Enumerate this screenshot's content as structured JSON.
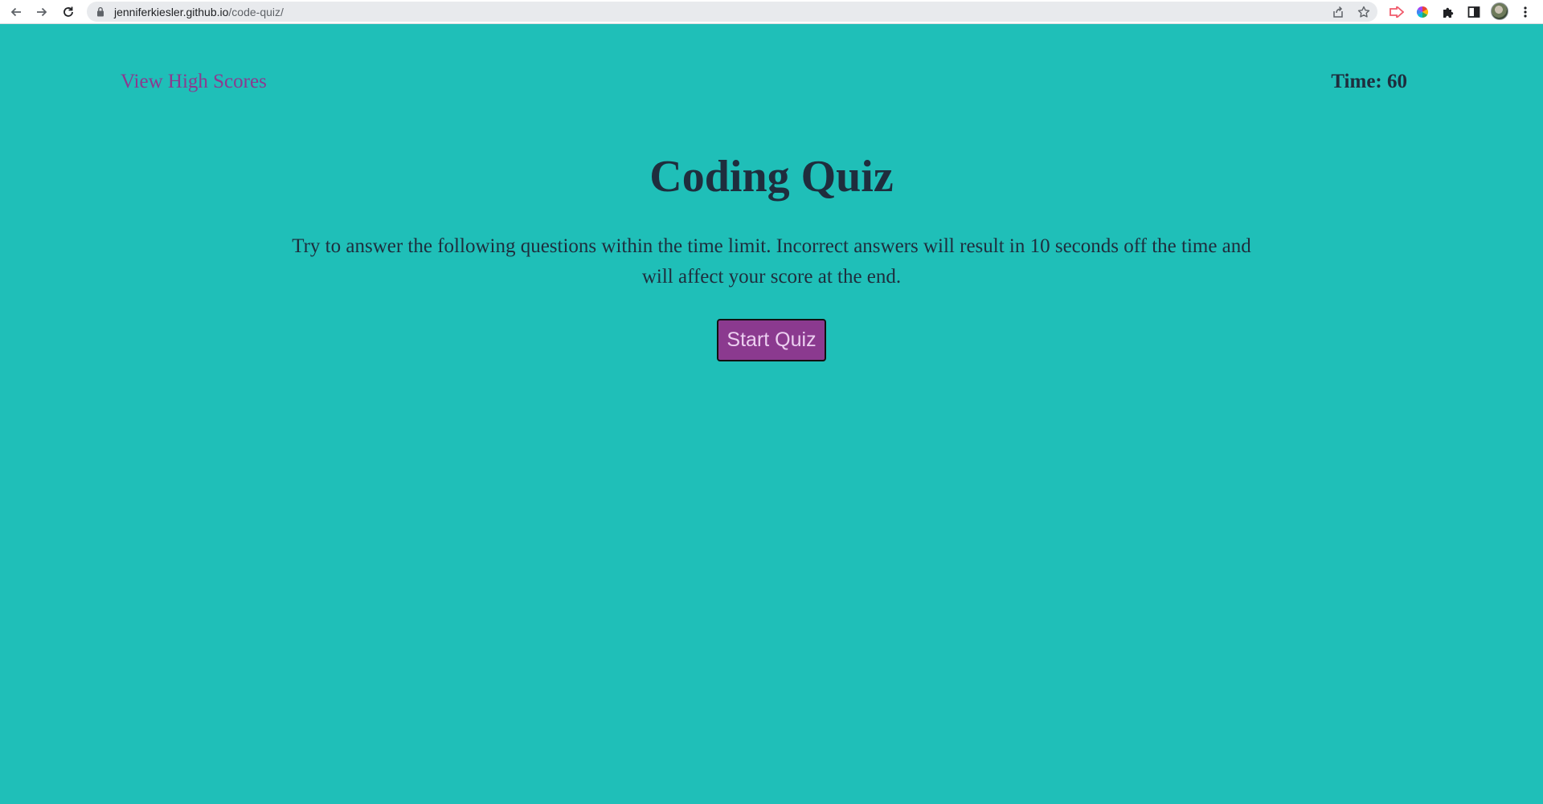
{
  "browser": {
    "url_host": "jenniferkiesler.github.io",
    "url_path": "/code-quiz/"
  },
  "header": {
    "high_scores_link": "View High Scores",
    "timer_label": "Time: 60"
  },
  "main": {
    "title": "Coding Quiz",
    "description": "Try to answer the following questions within the time limit. Incorrect answers will result in 10 seconds off the time and will affect your score at the end.",
    "start_button": "Start Quiz"
  },
  "colors": {
    "background": "#1fbfb8",
    "accent": "#8b3a8f",
    "text": "#1f2d3d"
  },
  "icons": {
    "back": "back-arrow-icon",
    "forward": "forward-arrow-icon",
    "reload": "reload-icon",
    "lock": "lock-icon",
    "share": "share-icon",
    "bookmark": "star-icon",
    "extensions": [
      "red-arrow-extension-icon",
      "color-wheel-extension-icon",
      "puzzle-icon",
      "side-panel-icon"
    ],
    "menu": "kebab-menu-icon"
  }
}
